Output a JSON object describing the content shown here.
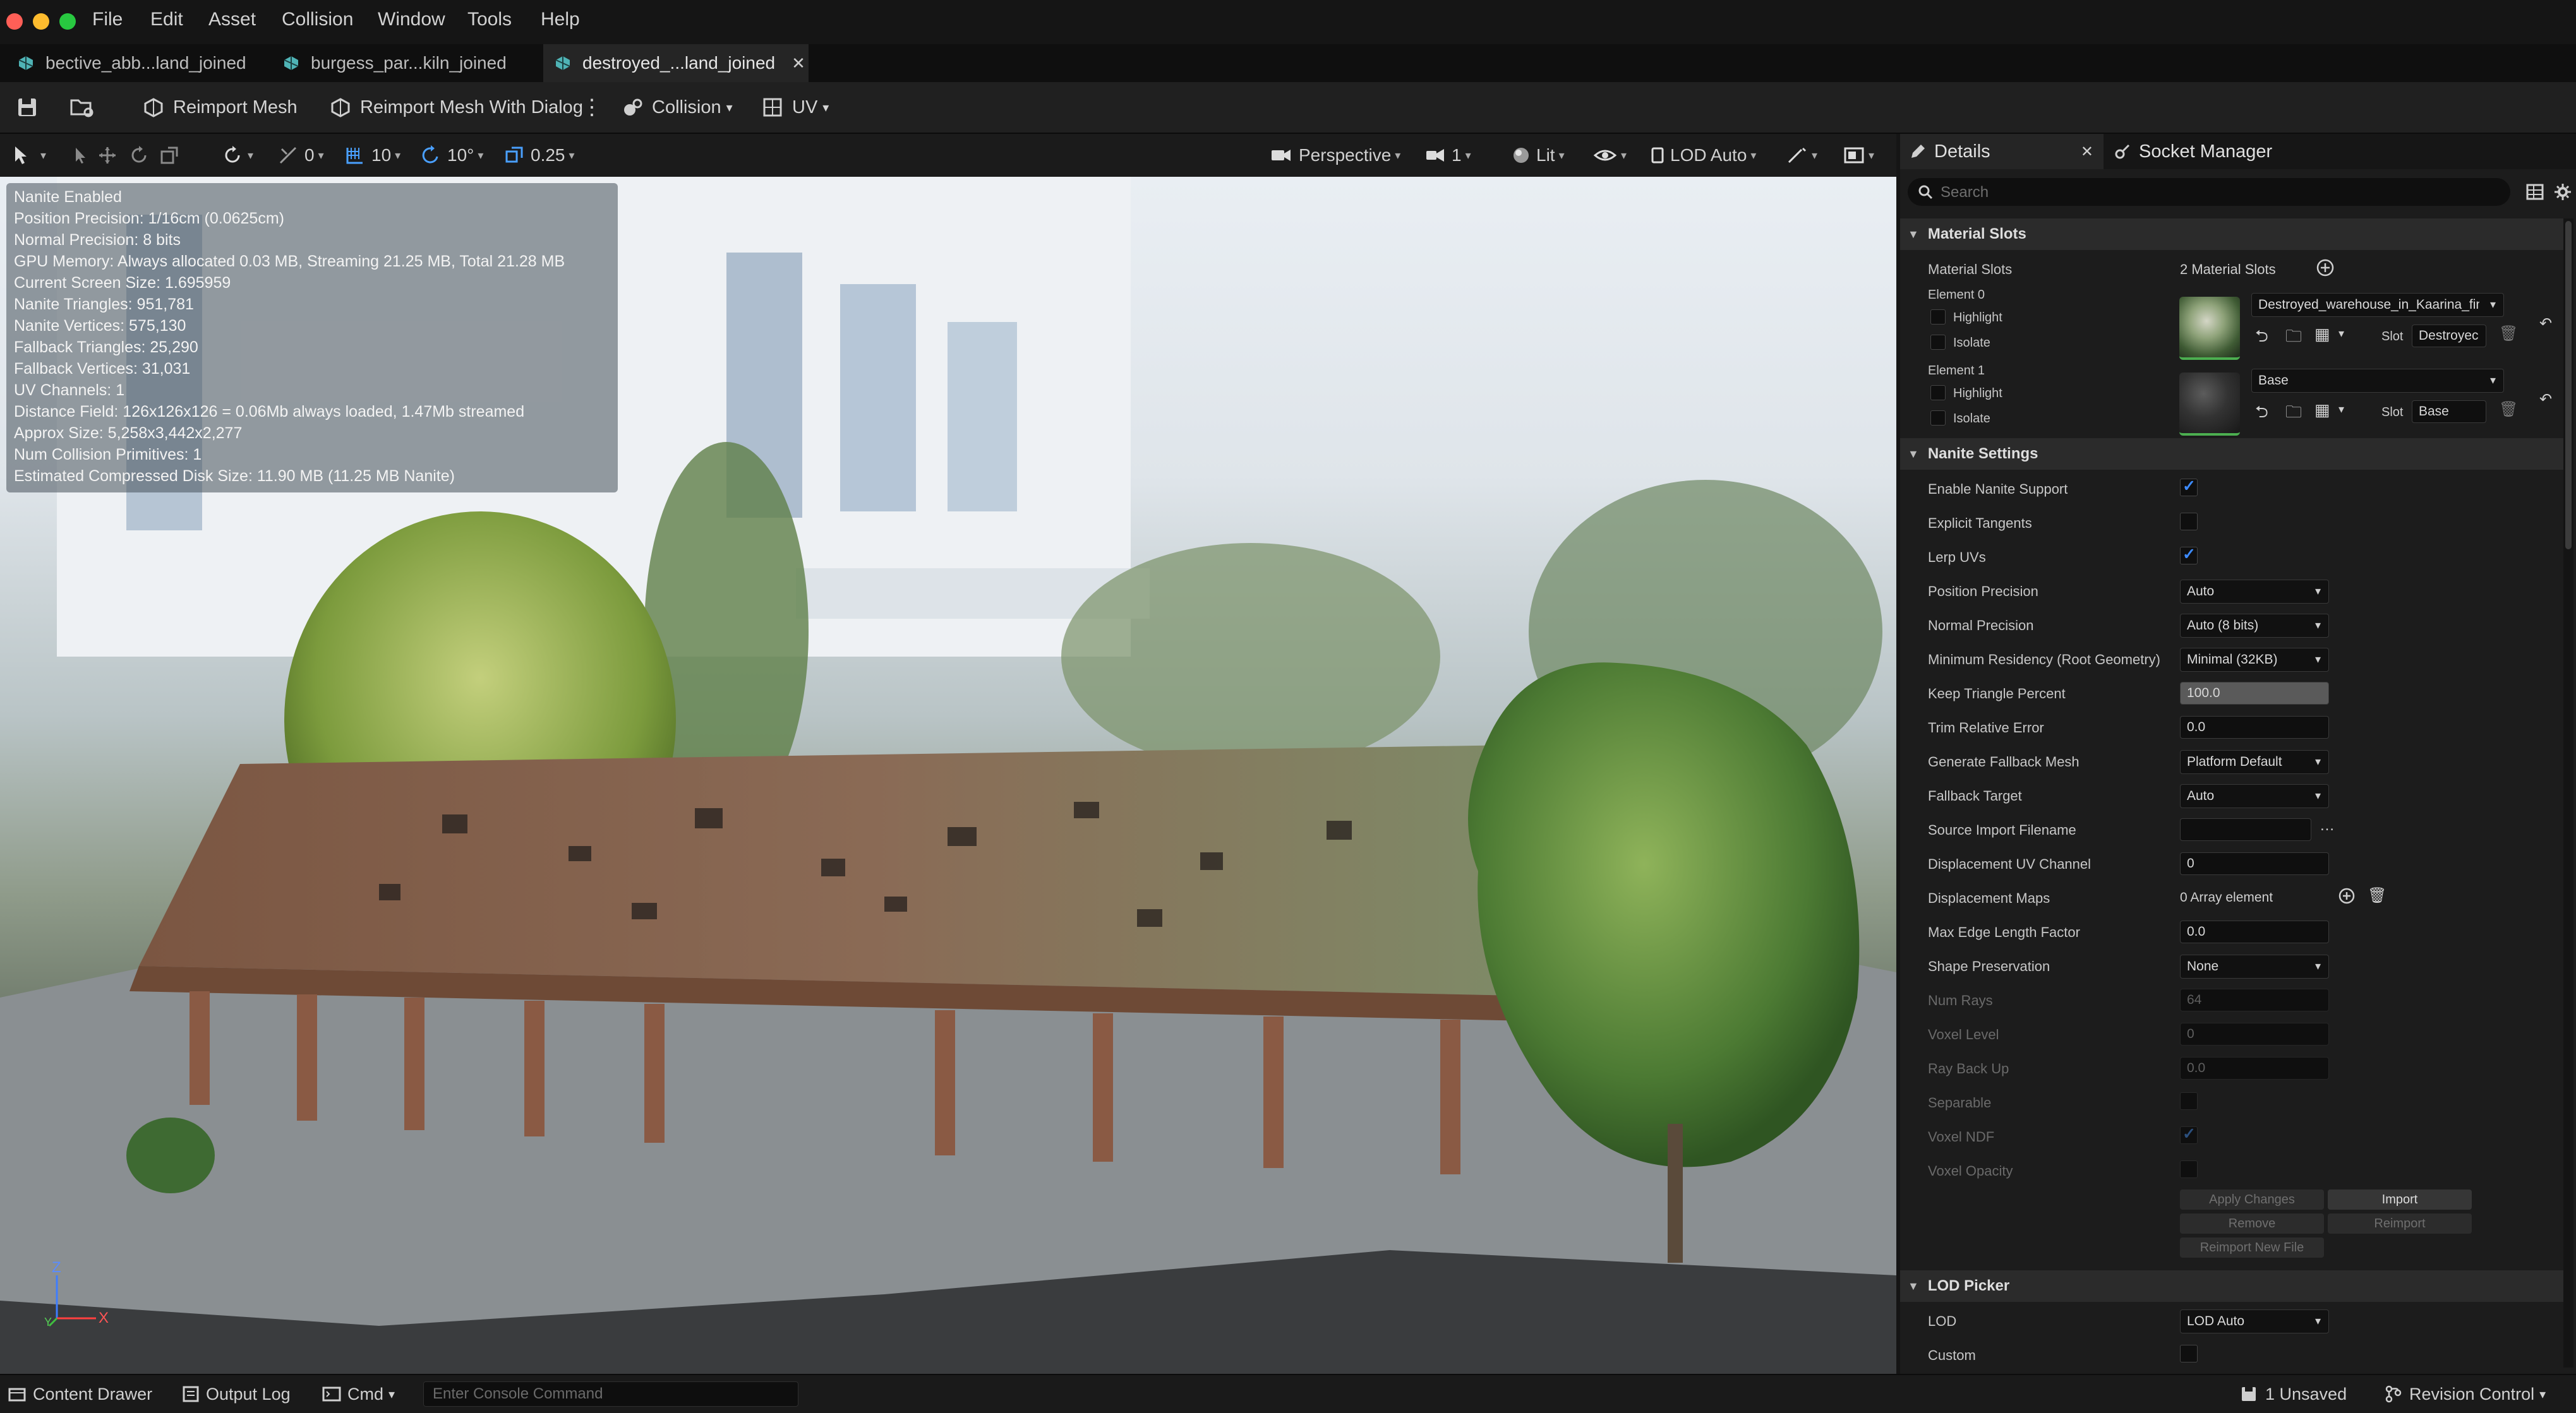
{
  "menu": {
    "items": [
      "File",
      "Edit",
      "Asset",
      "Collision",
      "Window",
      "Tools",
      "Help"
    ]
  },
  "tabs": [
    {
      "label": "bective_abb...land_joined"
    },
    {
      "label": "burgess_par...kiln_joined"
    },
    {
      "label": "destroyed_...land_joined",
      "active": true
    }
  ],
  "toolbar": {
    "reimport": "Reimport Mesh",
    "reimport_dialog": "Reimport Mesh With Dialog",
    "collision": "Collision",
    "uv": "UV"
  },
  "viewport_bar": {
    "rotate_snap_count": "0",
    "grid_snap": "10",
    "angle_snap": "10°",
    "scale_snap": "0.25",
    "perspective": "Perspective",
    "camera_speed": "1",
    "lit": "Lit",
    "lod": "LOD Auto"
  },
  "stats": [
    "Nanite Enabled",
    "Position Precision: 1/16cm (0.0625cm)",
    "Normal Precision: 8 bits",
    "GPU Memory: Always allocated 0.03 MB, Streaming 21.25 MB, Total 21.28 MB",
    "Current Screen Size:  1.695959",
    "Nanite Triangles:  951,781",
    "Nanite Vertices:  575,130",
    "Fallback Triangles:  25,290",
    "Fallback Vertices:  31,031",
    "UV Channels:  1",
    "Distance Field:  126x126x126 = 0.06Mb always loaded, 1.47Mb streamed",
    "Approx Size: 5,258x3,442x2,277",
    "Num Collision Primitives:  1",
    "Estimated Compressed Disk Size: 11.90 MB (11.25 MB Nanite)"
  ],
  "axes": {
    "z": "Z",
    "x": "X",
    "y": "Y"
  },
  "details": {
    "tab_details": "Details",
    "tab_socket": "Socket Manager",
    "search_placeholder": "Search",
    "material_slots": {
      "header": "Material Slots",
      "label": "Material Slots",
      "count": "2 Material Slots",
      "element0": {
        "label": "Element 0",
        "highlight": "Highlight",
        "isolate": "Isolate",
        "material": "Destroyed_warehouse_in_Kaarina_finla",
        "slot_label": "Slot",
        "slot": "Destroyec"
      },
      "element1": {
        "label": "Element 1",
        "highlight": "Highlight",
        "isolate": "Isolate",
        "material": "Base",
        "slot_label": "Slot",
        "slot": "Base"
      }
    },
    "nanite": {
      "header": "Nanite Settings",
      "enable": "Enable Nanite Support",
      "explicit_tangents": "Explicit Tangents",
      "lerp_uvs": "Lerp UVs",
      "position_precision": {
        "label": "Position Precision",
        "value": "Auto"
      },
      "normal_precision": {
        "label": "Normal Precision",
        "value": "Auto (8 bits)"
      },
      "min_residency": {
        "label": "Minimum Residency (Root Geometry)",
        "value": "Minimal (32KB)"
      },
      "keep_triangle": {
        "label": "Keep Triangle Percent",
        "value": "100.0",
        "fraction": 1.0
      },
      "trim_error": {
        "label": "Trim Relative Error",
        "value": "0.0"
      },
      "generate_fallback": {
        "label": "Generate Fallback Mesh",
        "value": "Platform Default"
      },
      "fallback_target": {
        "label": "Fallback Target",
        "value": "Auto"
      },
      "source_import": {
        "label": "Source Import Filename",
        "value": ""
      },
      "displacement_uv": {
        "label": "Displacement UV Channel",
        "value": "0"
      },
      "displacement_maps": {
        "label": "Displacement Maps",
        "value": "0 Array element"
      },
      "max_edge": {
        "label": "Max Edge Length Factor",
        "value": "0.0"
      },
      "shape_preservation": {
        "label": "Shape Preservation",
        "value": "None"
      },
      "num_rays": {
        "label": "Num Rays",
        "value": "64"
      },
      "voxel_level": {
        "label": "Voxel Level",
        "value": "0"
      },
      "ray_back_up": {
        "label": "Ray Back Up",
        "value": "0.0"
      },
      "separable": "Separable",
      "voxel_ndf": "Voxel NDF",
      "voxel_opacity": "Voxel Opacity",
      "apply_changes": "Apply Changes",
      "import": "Import",
      "remove": "Remove",
      "reimport": "Reimport",
      "reimport_new": "Reimport New File"
    },
    "lod_picker": {
      "header": "LOD Picker",
      "lod": {
        "label": "LOD",
        "value": "LOD Auto"
      },
      "custom": "Custom"
    }
  },
  "statusbar": {
    "content_drawer": "Content Drawer",
    "output_log": "Output Log",
    "cmd": "Cmd",
    "console_placeholder": "Enter Console Command",
    "unsaved": "1 Unsaved",
    "revision": "Revision Control"
  },
  "colors": {
    "accent": "#3d8bff",
    "tab_active": "#252525",
    "panel": "#1c1c1c"
  }
}
